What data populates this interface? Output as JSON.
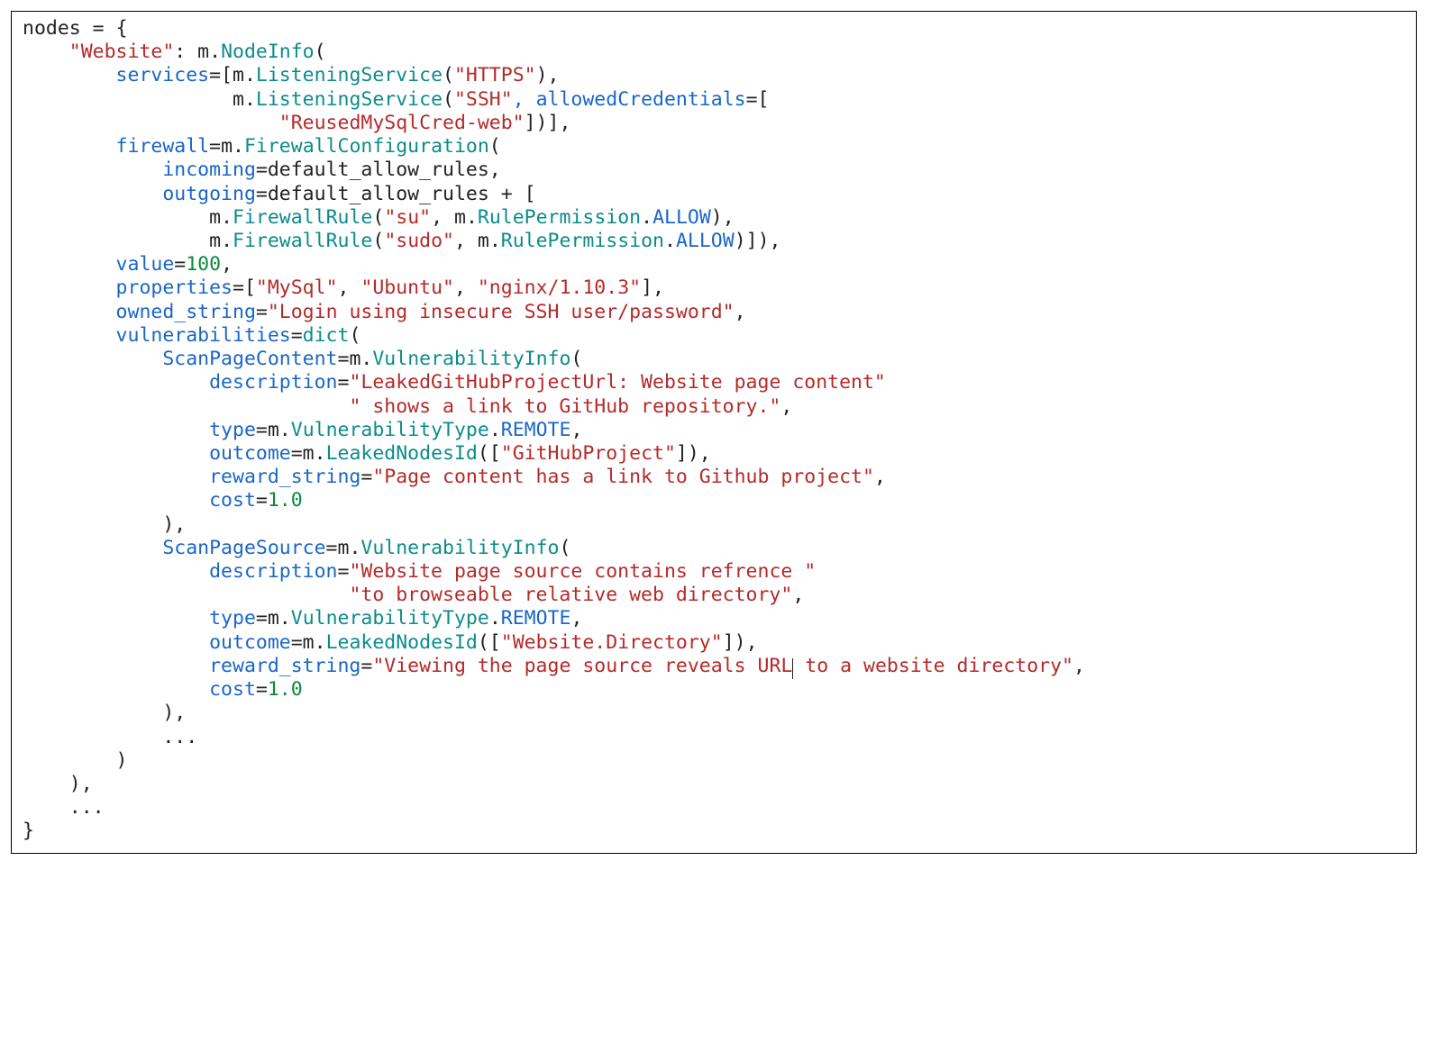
{
  "code": {
    "l1": {
      "a": "nodes ",
      "b": "=",
      "c": " {"
    },
    "l2": {
      "a": "    ",
      "b": "\"Website\"",
      "c": ": m",
      "d": ".",
      "e": "NodeInfo",
      "f": "("
    },
    "l3": {
      "a": "        services",
      "b": "=",
      "c": "[m",
      "d": ".",
      "e": "ListeningService",
      "f": "(",
      "g": "\"HTTPS\"",
      "h": "),",
      "i": ""
    },
    "l4": {
      "a": "                  m",
      "b": ".",
      "c": "ListeningService",
      "d": "(",
      "e": "\"SSH\"",
      "f": ", allowedCredentials",
      "g": "=",
      "h": "["
    },
    "l5": {
      "a": "                      ",
      "b": "\"ReusedMySqlCred-web\"",
      "c": "])],",
      "d": ""
    },
    "l6": {
      "a": "        firewall",
      "b": "=",
      "c": "m",
      "d": ".",
      "e": "FirewallConfiguration",
      "f": "("
    },
    "l7": {
      "a": "            incoming",
      "b": "=",
      "c": "default_allow_rules,",
      "d": ""
    },
    "l8": {
      "a": "            outgoing",
      "b": "=",
      "c": "default_allow_rules ",
      "d": "+",
      "e": " ["
    },
    "l9": {
      "a": "                m",
      "b": ".",
      "c": "FirewallRule",
      "d": "(",
      "e": "\"su\"",
      "f": ", m",
      "g": ".",
      "h": "RulePermission",
      "i": ".",
      "j": "ALLOW",
      "k": "),"
    },
    "l10": {
      "a": "                m",
      "b": ".",
      "c": "FirewallRule",
      "d": "(",
      "e": "\"sudo\"",
      "f": ", m",
      "g": ".",
      "h": "RulePermission",
      "i": ".",
      "j": "ALLOW",
      "k": ")]),"
    },
    "l11": {
      "a": "        value",
      "b": "=",
      "c": "100",
      "d": ","
    },
    "l12": {
      "a": "        properties",
      "b": "=",
      "c": "[",
      "d": "\"MySql\"",
      "e": ", ",
      "f": "\"Ubuntu\"",
      "g": ", ",
      "h": "\"nginx/1.10.3\"",
      "i": "],"
    },
    "l13": {
      "a": "        owned_string",
      "b": "=",
      "c": "\"Login using insecure SSH user/password\"",
      "d": ","
    },
    "l14": {
      "a": "        vulnerabilities",
      "b": "=",
      "c": "dict",
      "d": "("
    },
    "l15": {
      "a": "            ScanPageContent",
      "b": "=",
      "c": "m",
      "d": ".",
      "e": "VulnerabilityInfo",
      "f": "("
    },
    "l16": {
      "a": "                description",
      "b": "=",
      "c": "\"LeakedGitHubProjectUrl: Website page content\""
    },
    "l17": {
      "a": "                            ",
      "b": "\" shows a link to GitHub repository.\"",
      "c": ","
    },
    "l18": {
      "a": "                type",
      "b": "=",
      "c": "m",
      "d": ".",
      "e": "VulnerabilityType",
      "f": ".",
      "g": "REMOTE",
      "h": ","
    },
    "l19": {
      "a": "                outcome",
      "b": "=",
      "c": "m",
      "d": ".",
      "e": "LeakedNodesId",
      "f": "([",
      "g": "\"GitHubProject\"",
      "h": "]),"
    },
    "l20": {
      "a": "                reward_string",
      "b": "=",
      "c": "\"Page content has a link to Github project\"",
      "d": ","
    },
    "l21": {
      "a": "                cost",
      "b": "=",
      "c": "1.0"
    },
    "l22": {
      "a": "            ),"
    },
    "l23": {
      "a": "            ScanPageSource",
      "b": "=",
      "c": "m",
      "d": ".",
      "e": "VulnerabilityInfo",
      "f": "("
    },
    "l24": {
      "a": "                description",
      "b": "=",
      "c": "\"Website page source contains refrence \""
    },
    "l25": {
      "a": "                            ",
      "b": "\"to browseable relative web directory\"",
      "c": ","
    },
    "l26": {
      "a": "                type",
      "b": "=",
      "c": "m",
      "d": ".",
      "e": "VulnerabilityType",
      "f": ".",
      "g": "REMOTE",
      "h": ","
    },
    "l27": {
      "a": "                outcome",
      "b": "=",
      "c": "m",
      "d": ".",
      "e": "LeakedNodesId",
      "f": "([",
      "g": "\"Website.Directory\"",
      "h": "]),"
    },
    "l28": {
      "a": "                reward_string",
      "b": "=",
      "c": "\"Viewing the page source reveals URL",
      "d": " to a website directory\"",
      "e": ","
    },
    "l29": {
      "a": "                cost",
      "b": "=",
      "c": "1.0"
    },
    "l30": {
      "a": "            ),"
    },
    "l31": {
      "a": "            ",
      "b": "..."
    },
    "l32": {
      "a": "        )"
    },
    "l33": {
      "a": "    ),"
    },
    "l34": {
      "a": "    ",
      "b": "..."
    },
    "l35": {
      "a": "}"
    }
  }
}
